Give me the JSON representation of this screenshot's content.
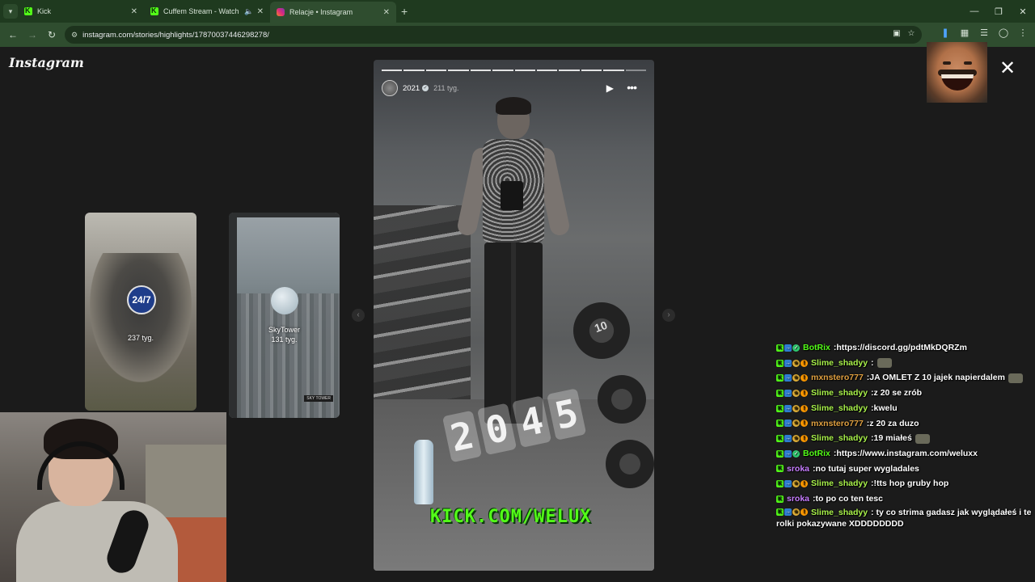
{
  "browser": {
    "tabs": [
      {
        "title": "Kick",
        "favicon": "kick-icon",
        "active": false
      },
      {
        "title": "Cuffem Stream - Watch Live",
        "favicon": "kick-icon",
        "active": false,
        "audio": true
      },
      {
        "title": "Relacje • Instagram",
        "favicon": "instagram-icon",
        "active": true
      }
    ],
    "new_tab_label": "+",
    "url": "instagram.com/stories/highlights/17870037446298278/",
    "accent_color": "#2f4d2f"
  },
  "instagram": {
    "logo": "Instagram",
    "previews": [
      {
        "title": "",
        "time": "237 tyg."
      },
      {
        "title": "SkyTower",
        "time": "131 tyg.",
        "tag": "SKY TOWER"
      }
    ],
    "badge_text": "24/7",
    "story": {
      "name": "2021",
      "time": "211 tyg.",
      "counter": [
        "2",
        "0",
        "4",
        "5"
      ],
      "plate_text": "10"
    }
  },
  "stream": {
    "banner": "KICK.COM/WELUX",
    "banner_color": "#53fc18"
  },
  "chat": [
    {
      "badges": [
        "k",
        "m",
        "v"
      ],
      "user": "BotRix",
      "color": "#53fc18",
      "text": "https://discord.gg/pdtMkDQRZm"
    },
    {
      "badges": [
        "k",
        "m",
        "s",
        "o"
      ],
      "user": "Slime_shadyy",
      "color": "#a8f04a",
      "text": "",
      "emote": true
    },
    {
      "badges": [
        "k",
        "m",
        "s",
        "o"
      ],
      "user": "mxnstero777",
      "color": "#e0a040",
      "text": "JA OMLET Z 10 jajek napierdalem",
      "emote": true
    },
    {
      "badges": [
        "k",
        "m",
        "s",
        "o"
      ],
      "user": "Slime_shadyy",
      "color": "#a8f04a",
      "text": "z 20 se zrób"
    },
    {
      "badges": [
        "k",
        "m",
        "s",
        "o"
      ],
      "user": "Slime_shadyy",
      "color": "#a8f04a",
      "text": "kwelu"
    },
    {
      "badges": [
        "k",
        "m",
        "s",
        "o"
      ],
      "user": "mxnstero777",
      "color": "#e0a040",
      "text": "z 20 za duzo"
    },
    {
      "badges": [
        "k",
        "m",
        "s",
        "o"
      ],
      "user": "Slime_shadyy",
      "color": "#a8f04a",
      "text": "19 miałeś",
      "emote": true
    },
    {
      "badges": [
        "k",
        "m",
        "v"
      ],
      "user": "BotRix",
      "color": "#53fc18",
      "text": "https://www.instagram.com/weluxx"
    },
    {
      "badges": [
        "k"
      ],
      "user": "sroka",
      "color": "#c77dff",
      "text": "no tutaj super wygladales"
    },
    {
      "badges": [
        "k",
        "m",
        "s",
        "o"
      ],
      "user": "Slime_shadyy",
      "color": "#a8f04a",
      "text": "!tts hop gruby hop"
    },
    {
      "badges": [
        "k"
      ],
      "user": "sroka",
      "color": "#c77dff",
      "text": "to po co ten tesc"
    },
    {
      "badges": [
        "k",
        "m",
        "s",
        "o"
      ],
      "user": "Slime_shadyy",
      "color": "#a8f04a",
      "text": "ty co strima gadasz jak wyglądałeś i te rolki pokazywane XDDDDDDDD",
      "wrap": true
    }
  ]
}
